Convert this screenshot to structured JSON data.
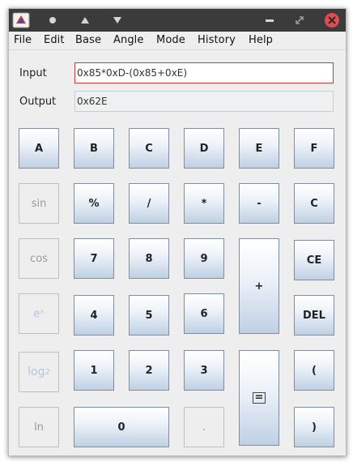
{
  "menu": [
    "File",
    "Edit",
    "Base",
    "Angle",
    "Mode",
    "History",
    "Help"
  ],
  "input": {
    "label": "Input",
    "value": "0x85*0xD-(0x85+0xE)"
  },
  "output": {
    "label": "Output",
    "value": "0x62E"
  },
  "keys": {
    "a": "A",
    "b": "B",
    "c_hex": "C",
    "d": "D",
    "e": "E",
    "f": "F",
    "sin": "sin",
    "percent": "%",
    "divide": "/",
    "multiply": "*",
    "minus": "-",
    "clear": "C",
    "cos": "cos",
    "seven": "7",
    "eight": "8",
    "nine": "9",
    "plus": "+",
    "clear_entry": "CE",
    "exp": "eˣ",
    "four": "4",
    "five": "5",
    "six": "6",
    "delete": "DEL",
    "log2_base": "log",
    "log2_sub": "2",
    "one": "1",
    "two": "2",
    "three": "3",
    "equals": "=",
    "open_paren": "(",
    "ln": "ln",
    "zero": "0",
    "dot": ".",
    "close_paren": ")"
  },
  "colors": {
    "titlebar": "#3b3b3b",
    "close_button": "#e34c4c",
    "input_border": "#c43a3a",
    "key_gradient_end": "#bfd0e4"
  },
  "icons": [
    "app-icon",
    "dot-icon",
    "triangle-up-icon",
    "triangle-down-icon",
    "minimize-icon",
    "restore-icon",
    "close-icon"
  ]
}
